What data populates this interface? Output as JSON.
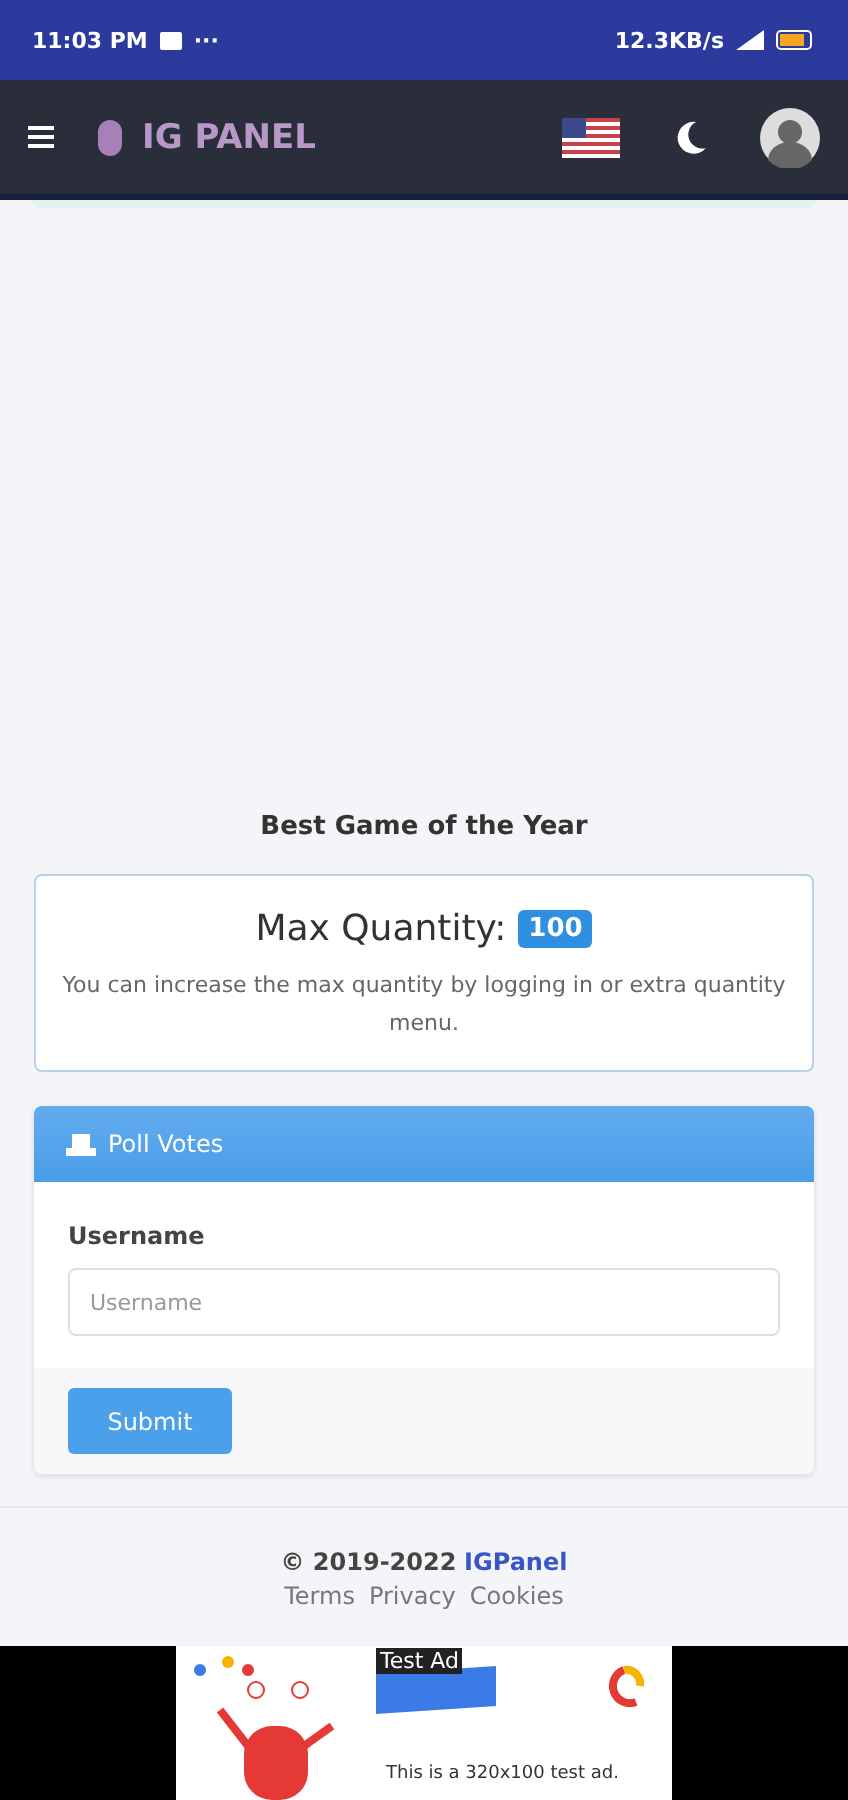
{
  "status_bar": {
    "time": "11:03 PM",
    "more": "···",
    "speed": "12.3KB/s"
  },
  "navbar": {
    "brand": "IG PANEL"
  },
  "section_title": "Best Game of the Year",
  "quantity_card": {
    "label": "Max Quantity:",
    "badge": "100",
    "note": "You can increase the max quantity by logging in or extra quantity menu."
  },
  "poll_card": {
    "header": "Poll Votes",
    "field_label": "Username",
    "placeholder": "Username",
    "submit": "Submit"
  },
  "footer": {
    "copyright": "© 2019-2022",
    "brand_link": "IGPanel",
    "links": [
      "Terms",
      "Privacy",
      "Cookies"
    ]
  },
  "ad": {
    "tag": "Test Ad",
    "text": "This is a 320x100 test ad."
  }
}
